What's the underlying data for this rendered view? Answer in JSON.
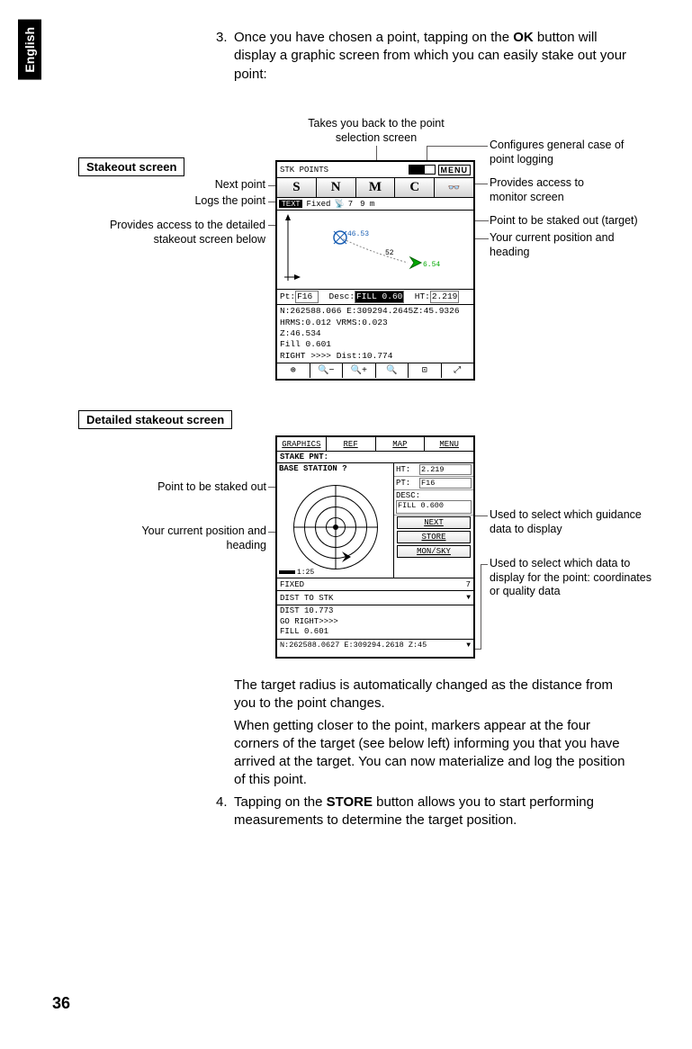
{
  "language_tab": "English",
  "page_number": "36",
  "intro": {
    "num": "3.",
    "text_a": "Once you have chosen a point, tapping on the ",
    "ok": "OK",
    "text_b": " button will display a graphic screen from which you can easily stake out your point:"
  },
  "labels": {
    "stakeout_screen": "Stakeout screen",
    "detailed_stakeout_screen": "Detailed stakeout screen"
  },
  "callouts1": {
    "top_center": "Takes you back to the point selection screen",
    "next_point": "Next point",
    "logs_point": "Logs the point",
    "access_detailed": "Provides access to the detailed stakeout screen below",
    "configures": "Configures general case of point logging",
    "monitor": "Provides access to monitor screen",
    "target": "Point to be staked out (target)",
    "current": "Your current position and heading"
  },
  "callouts2": {
    "point_stake": "Point to be staked out",
    "current_pos": "Your current position and heading",
    "guidance": "Used to select which guidance data to display",
    "which_data": "Used to select which data to display for the point: coordinates or quality data"
  },
  "dev1": {
    "title": "STK POINTS",
    "menu": "MENU",
    "btn_s": "S",
    "btn_n": "N",
    "btn_m": "M",
    "btn_c": "C",
    "binoc": "👓",
    "status_text": "TEXT",
    "status_fixed": "Fixed",
    "status_sat": "7",
    "status_dist": "9 m",
    "marker1": "46.53",
    "marker2": "52",
    "marker3": "6.54",
    "pt_lbl": "Pt:",
    "pt_val": "F16",
    "desc_lbl": "Desc:",
    "desc_val": "FILL 0.60",
    "ht_lbl": "HT:",
    "ht_val": "2.219",
    "ne": "N:262588.066 E:309294.2645Z:45.9326",
    "hrms": "HRMS:0.012 VRMS:0.023",
    "z": "Z:46.534",
    "fill": "Fill 0.601",
    "right": "RIGHT >>>> Dist:10.774",
    "zoom": [
      "⊕",
      "🔍−",
      "🔍+",
      "🔍",
      "⊡",
      "⤢"
    ]
  },
  "dev2": {
    "tabs": [
      "GRAPHICS",
      "REF",
      "MAP",
      "MENU"
    ],
    "title": "STAKE PNT:",
    "base": "BASE STATION ?",
    "ht_lbl": "HT:",
    "ht_val": "2.219",
    "pt_lbl": "PT:",
    "pt_val": "F16",
    "desc_lbl": "DESC:",
    "desc_val": "FILL 0.600",
    "btn_next": "NEXT",
    "btn_store": "STORE",
    "btn_monsky": "MON/SKY",
    "status_fixed": "FIXED",
    "status_sat": "7",
    "dd_guidance": "DIST TO STK",
    "dist": "DIST 10.773",
    "goright": "GO RIGHT>>>>",
    "fill": "FILL 0.601",
    "coord": "N:262588.0627 E:309294.2618 Z:45",
    "scale": "1:25"
  },
  "closing": {
    "p1": "The target radius is automatically changed as the distance from you to the point changes.",
    "p2": "When getting closer to the point, markers appear at the four corners of the target (see below left) informing you that you have arrived at the target. You can now material­ize and log the position of this point.",
    "num4": "4.",
    "p3a": "Tapping on the ",
    "store": "STORE",
    "p3b": " button allows you to start perform­ing measurements to determine the target position."
  }
}
